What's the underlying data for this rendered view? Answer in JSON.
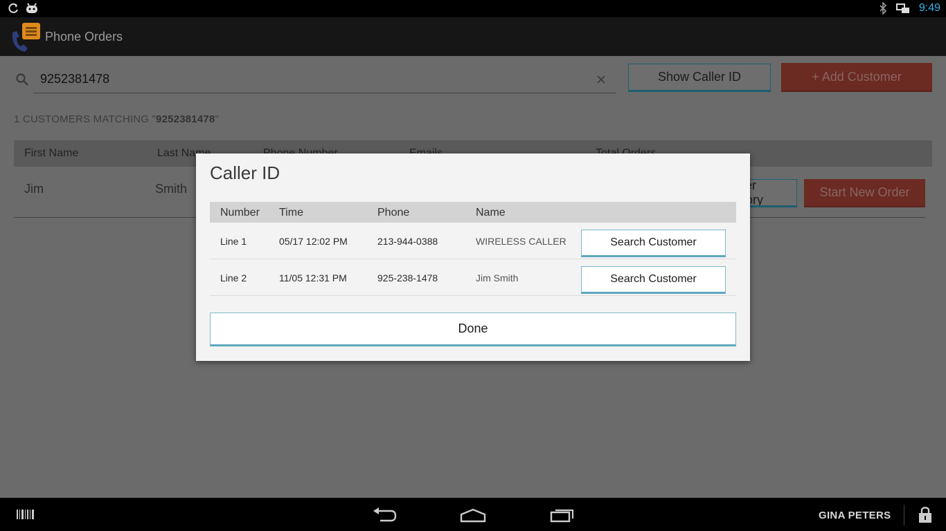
{
  "status_bar": {
    "time": "9:49"
  },
  "app": {
    "title": "Phone Orders"
  },
  "search": {
    "value": "9252381478",
    "placeholder": ""
  },
  "actions": {
    "show_caller_id": "Show Caller ID",
    "add_customer": "+ Add Customer"
  },
  "results": {
    "prefix": "1 CUSTOMERS MATCHING \"",
    "query": "9252381478",
    "suffix": "\""
  },
  "customer_table": {
    "headers": [
      "First Name",
      "Last Name",
      "Phone Number",
      "Emails",
      "Total Orders"
    ],
    "rows": [
      {
        "first_name": "Jim",
        "last_name": "Smith"
      }
    ],
    "history_label": "Order History",
    "new_order_label": "Start New Order"
  },
  "dialog": {
    "title": "Caller ID",
    "headers": [
      "Number",
      "Time",
      "Phone",
      "Name"
    ],
    "rows": [
      {
        "number": "Line 1",
        "time": "05/17 12:02 PM",
        "phone": "213-944-0388",
        "name": "WIRELESS CALLER",
        "action": "Search Customer"
      },
      {
        "number": "Line 2",
        "time": "11/05 12:31 PM",
        "phone": "925-238-1478",
        "name": "Jim Smith",
        "action": "Search Customer"
      }
    ],
    "done_label": "Done"
  },
  "nav_bar": {
    "user": "GINA PETERS"
  },
  "colors": {
    "accent": "#33b5e5",
    "button_border": "#5ea8bf",
    "danger": "#d9534f"
  }
}
